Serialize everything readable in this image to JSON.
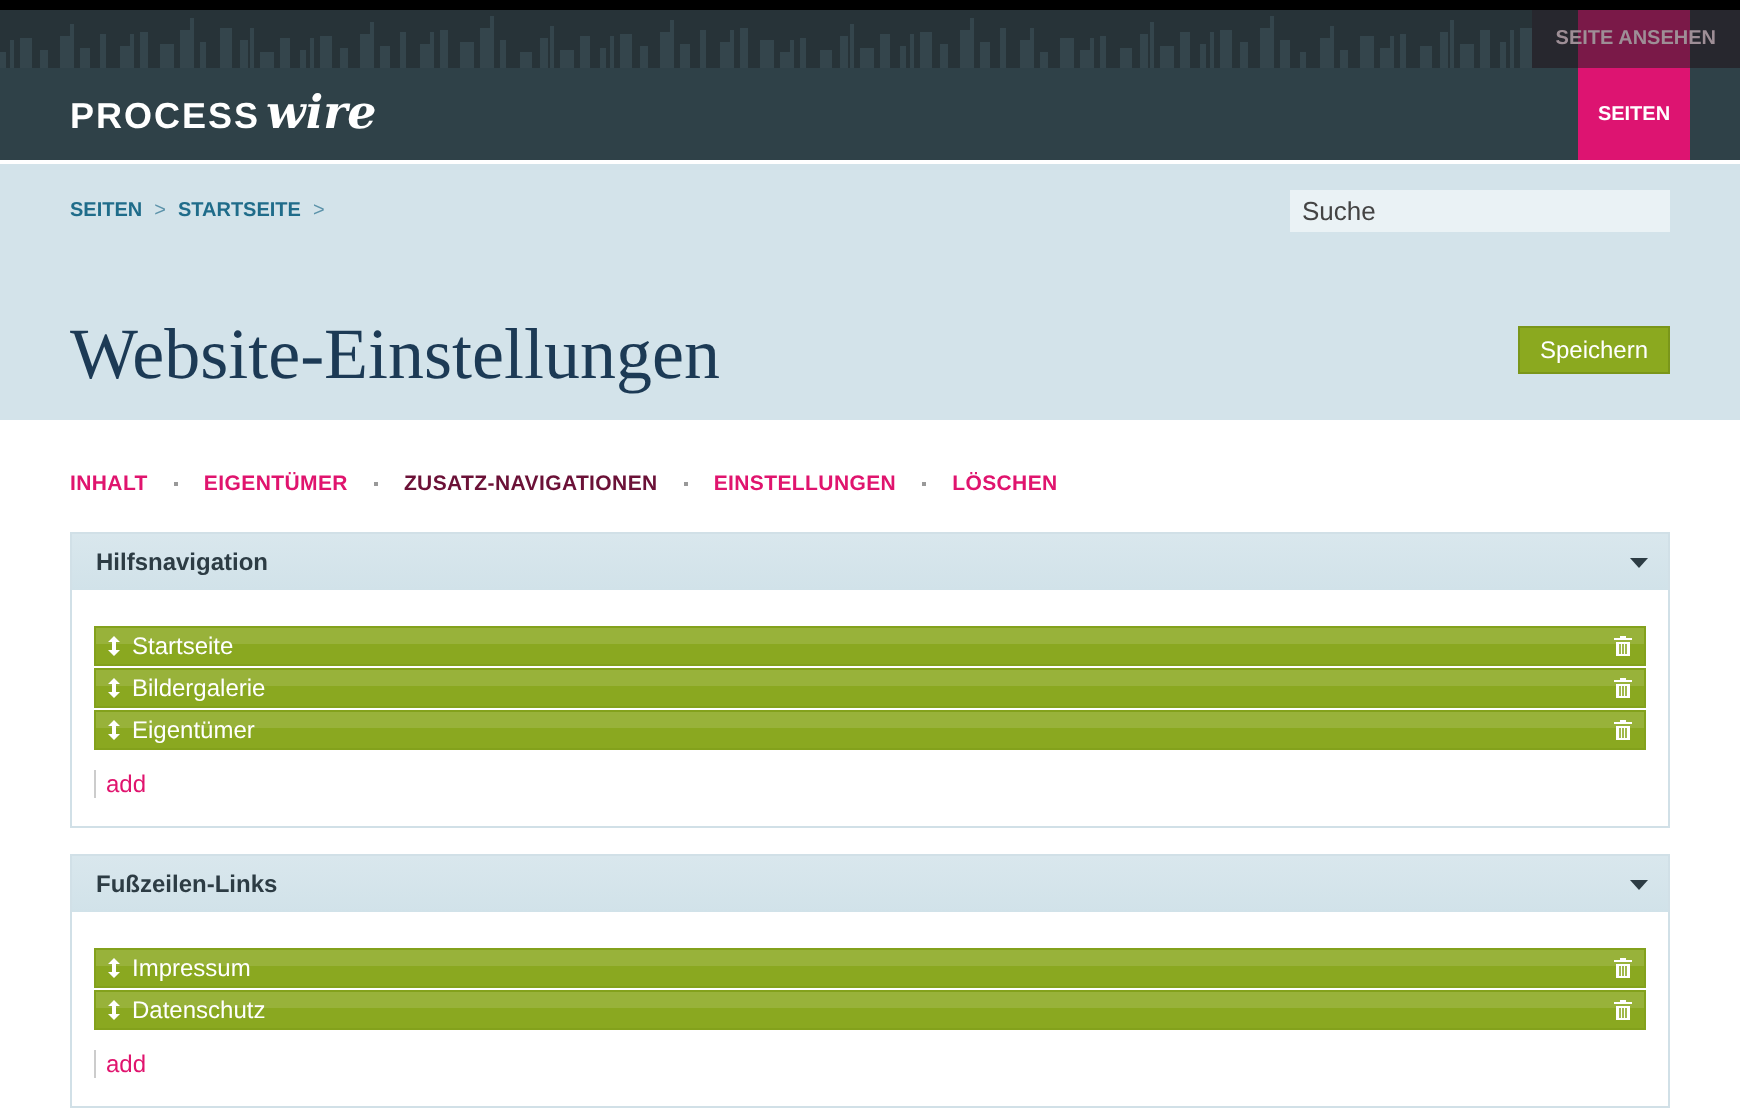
{
  "header": {
    "logo_bold": "PROCESS",
    "logo_script": "wire",
    "view_link": "SEITE ANSEHEN",
    "nav": [
      {
        "label": "SEITEN",
        "selected": true
      }
    ]
  },
  "breadcrumbs": [
    {
      "label": "SEITEN",
      "separator": ">"
    },
    {
      "label": "STARTSEITE",
      "separator": ">"
    }
  ],
  "search": {
    "placeholder": "Suche"
  },
  "page_title": "Website-Einstellungen",
  "save_button": "Speichern",
  "tabs": [
    {
      "label": "INHALT",
      "selected": false
    },
    {
      "label": "EIGENTÜMER",
      "selected": false
    },
    {
      "label": "ZUSATZ-NAVIGATIONEN",
      "selected": true
    },
    {
      "label": "EINSTELLUNGEN",
      "selected": false
    },
    {
      "label": "LÖSCHEN",
      "selected": false
    }
  ],
  "panels": [
    {
      "title": "Hilfsnavigation",
      "expanded": true,
      "items": [
        "Startseite",
        "Bildergalerie",
        "Eigentümer"
      ],
      "add_link": "add"
    },
    {
      "title": "Fußzeilen-Links",
      "expanded": true,
      "items": [
        "Impressum",
        "Datenschutz"
      ],
      "add_link": "add"
    }
  ]
}
